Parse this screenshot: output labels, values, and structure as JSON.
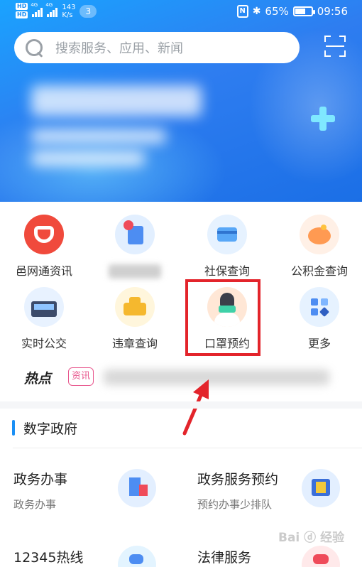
{
  "status_bar": {
    "network_speed_value": "143",
    "network_speed_unit": "K/s",
    "notification_count": "3",
    "nfc_label": "N",
    "battery_percent": "65%",
    "time": "09:56"
  },
  "search": {
    "placeholder": "搜索服务、应用、新闻"
  },
  "grid": [
    {
      "label": "邑网通资讯"
    },
    {
      "label": ""
    },
    {
      "label": "社保查询"
    },
    {
      "label": "公积金查询"
    },
    {
      "label": "实时公交"
    },
    {
      "label": "违章查询"
    },
    {
      "label": "口罩预约"
    },
    {
      "label": "更多"
    }
  ],
  "hot": {
    "title": "热点",
    "tag": "资讯"
  },
  "section": {
    "title": "数字政府"
  },
  "services": [
    {
      "title": "政务办事",
      "subtitle": "政务办事"
    },
    {
      "title": "政务服务预约",
      "subtitle": "预约办事少排队"
    },
    {
      "title": "12345热线",
      "subtitle": ""
    },
    {
      "title": "法律服务",
      "subtitle": ""
    }
  ],
  "colors": {
    "header_blue": "#2e7df0",
    "highlight_red": "#e3242b",
    "accent_blue": "#1a8ff5"
  }
}
